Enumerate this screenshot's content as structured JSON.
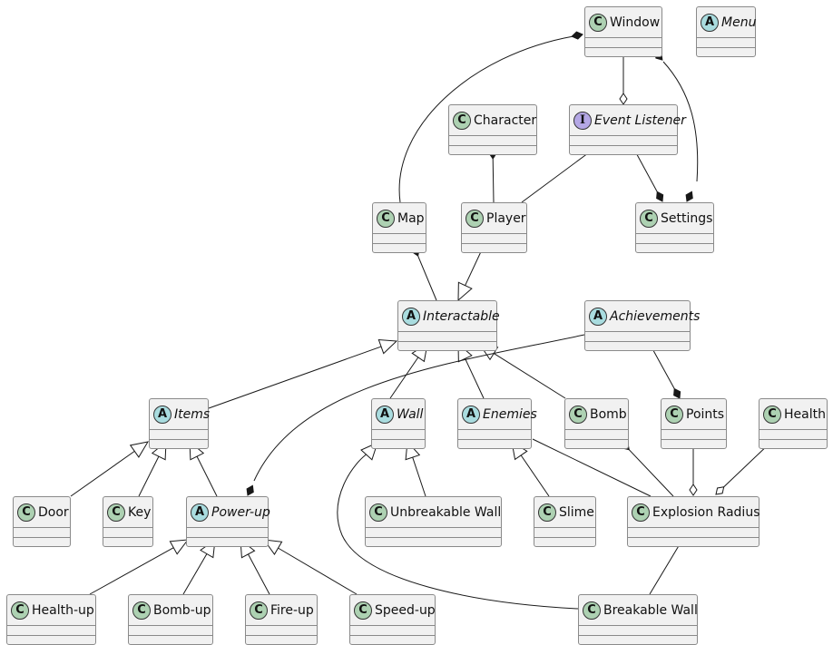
{
  "diagram": {
    "type": "uml-class-diagram",
    "classes": [
      {
        "id": "window",
        "name": "Window",
        "kind": "C"
      },
      {
        "id": "menu",
        "name": "Menu",
        "kind": "A"
      },
      {
        "id": "character",
        "name": "Character",
        "kind": "C"
      },
      {
        "id": "event-listener",
        "name": "Event Listener",
        "kind": "I"
      },
      {
        "id": "map",
        "name": "Map",
        "kind": "C"
      },
      {
        "id": "player",
        "name": "Player",
        "kind": "C"
      },
      {
        "id": "settings",
        "name": "Settings",
        "kind": "C"
      },
      {
        "id": "interactable",
        "name": "Interactable",
        "kind": "A"
      },
      {
        "id": "achievements",
        "name": "Achievements",
        "kind": "A"
      },
      {
        "id": "items",
        "name": "Items",
        "kind": "A"
      },
      {
        "id": "wall",
        "name": "Wall",
        "kind": "A"
      },
      {
        "id": "enemies",
        "name": "Enemies",
        "kind": "A"
      },
      {
        "id": "bomb",
        "name": "Bomb",
        "kind": "C"
      },
      {
        "id": "points",
        "name": "Points",
        "kind": "C"
      },
      {
        "id": "health",
        "name": "Health",
        "kind": "C"
      },
      {
        "id": "door",
        "name": "Door",
        "kind": "C"
      },
      {
        "id": "key",
        "name": "Key",
        "kind": "C"
      },
      {
        "id": "power-up",
        "name": "Power-up",
        "kind": "A"
      },
      {
        "id": "unbreakable-wall",
        "name": "Unbreakable Wall",
        "kind": "C"
      },
      {
        "id": "slime",
        "name": "Slime",
        "kind": "C"
      },
      {
        "id": "explosion-radius",
        "name": "Explosion Radius",
        "kind": "C"
      },
      {
        "id": "health-up",
        "name": "Health-up",
        "kind": "C"
      },
      {
        "id": "bomb-up",
        "name": "Bomb-up",
        "kind": "C"
      },
      {
        "id": "fire-up",
        "name": "Fire-up",
        "kind": "C"
      },
      {
        "id": "speed-up",
        "name": "Speed-up",
        "kind": "C"
      },
      {
        "id": "breakable-wall",
        "name": "Breakable Wall",
        "kind": "C"
      }
    ],
    "relations": [
      {
        "from": "window",
        "to": "map",
        "type": "composition"
      },
      {
        "from": "window",
        "to": "event-listener",
        "type": "aggregation"
      },
      {
        "from": "window",
        "to": "settings",
        "type": "composition"
      },
      {
        "from": "character",
        "to": "player",
        "type": "composition"
      },
      {
        "from": "event-listener",
        "to": "player",
        "type": "aggregation"
      },
      {
        "from": "settings",
        "to": "event-listener",
        "type": "composition"
      },
      {
        "from": "map",
        "to": "interactable",
        "type": "composition"
      },
      {
        "from": "player",
        "to": "interactable",
        "type": "inheritance"
      },
      {
        "from": "items",
        "to": "interactable",
        "type": "inheritance"
      },
      {
        "from": "wall",
        "to": "interactable",
        "type": "inheritance"
      },
      {
        "from": "enemies",
        "to": "interactable",
        "type": "inheritance"
      },
      {
        "from": "bomb",
        "to": "interactable",
        "type": "inheritance"
      },
      {
        "from": "points",
        "to": "achievements",
        "type": "composition"
      },
      {
        "from": "power-up",
        "to": "achievements",
        "type": "composition"
      },
      {
        "from": "door",
        "to": "items",
        "type": "inheritance"
      },
      {
        "from": "key",
        "to": "items",
        "type": "inheritance"
      },
      {
        "from": "power-up",
        "to": "items",
        "type": "inheritance"
      },
      {
        "from": "unbreakable-wall",
        "to": "wall",
        "type": "inheritance"
      },
      {
        "from": "breakable-wall",
        "to": "wall",
        "type": "inheritance"
      },
      {
        "from": "slime",
        "to": "enemies",
        "type": "inheritance"
      },
      {
        "from": "enemies",
        "to": "explosion-radius",
        "type": "association"
      },
      {
        "from": "bomb",
        "to": "explosion-radius",
        "type": "composition"
      },
      {
        "from": "explosion-radius",
        "to": "points",
        "type": "aggregation"
      },
      {
        "from": "explosion-radius",
        "to": "health",
        "type": "aggregation"
      },
      {
        "from": "explosion-radius",
        "to": "breakable-wall",
        "type": "association"
      },
      {
        "from": "health-up",
        "to": "power-up",
        "type": "inheritance"
      },
      {
        "from": "bomb-up",
        "to": "power-up",
        "type": "inheritance"
      },
      {
        "from": "fire-up",
        "to": "power-up",
        "type": "inheritance"
      },
      {
        "from": "speed-up",
        "to": "power-up",
        "type": "inheritance"
      }
    ]
  }
}
